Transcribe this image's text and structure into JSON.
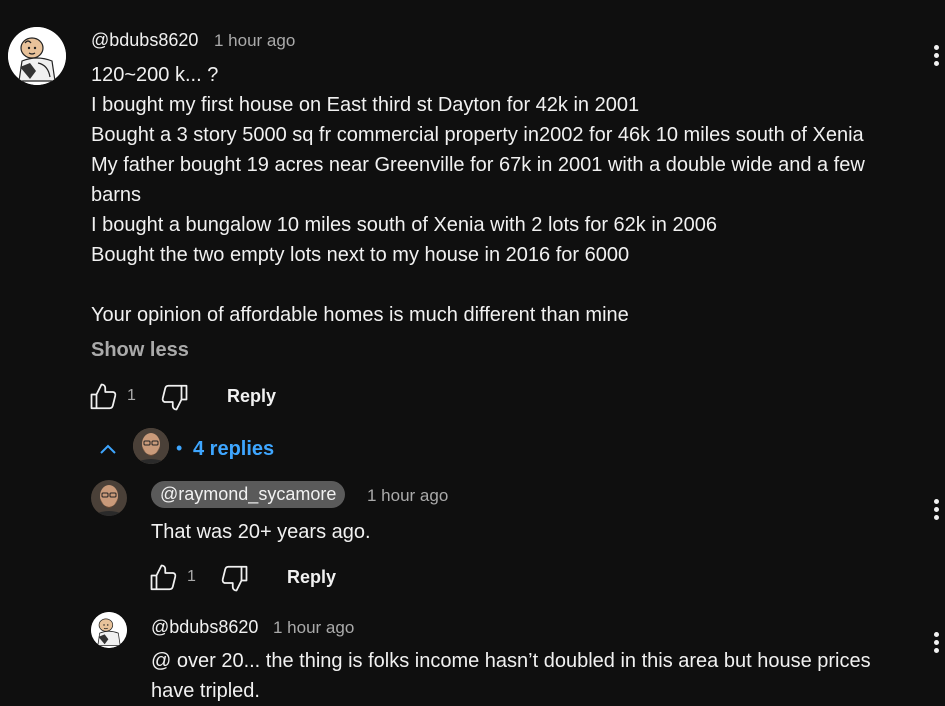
{
  "comment": {
    "author": "@bdubs8620",
    "time": "1 hour ago",
    "lines": [
      "120~200 k... ?",
      "I bought my first house on East third st Dayton for 42k in 2001",
      "Bought a 3 story 5000 sq fr commercial property in2002 for 46k 10 miles south of Xenia",
      "My father bought 19 acres near Greenville for 67k in 2001 with a double wide and a few",
      "barns",
      "I bought a bungalow 10 miles south of Xenia with 2 lots for 62k in 2006",
      "Bought the two empty lots next to my house in 2016 for 6000",
      "",
      "Your opinion of affordable homes is much different than mine"
    ],
    "show_less": "Show less",
    "like_count": "1",
    "reply_label": "Reply"
  },
  "replies_toggle": {
    "bullet": "•",
    "label": "4 replies"
  },
  "replies": [
    {
      "author": "@raymond_sycamore",
      "time": "1 hour ago",
      "lines": [
        "That was 20+ years ago."
      ],
      "like_count": "1",
      "reply_label": "Reply"
    },
    {
      "author": "@bdubs8620",
      "time": "1 hour ago",
      "lines": [
        "@ over 20... the thing is folks income hasn’t  doubled in this area but house prices",
        "have tripled."
      ]
    }
  ],
  "colors": {
    "background": "#0f0f0f",
    "text": "#f1f1f1",
    "muted": "#aaaaaa",
    "link": "#3ea6ff",
    "mention_pill": "#5a5a5a"
  },
  "icons": [
    "peanuts-avatar",
    "bearded-man-avatar",
    "thumb-up-icon",
    "thumb-down-icon",
    "chevron-up-icon",
    "more-vert-icon"
  ]
}
